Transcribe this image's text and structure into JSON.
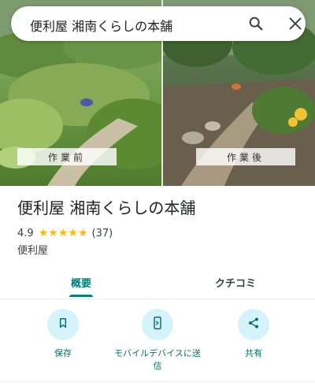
{
  "search": {
    "query": "便利屋 湘南くらしの本舗",
    "search_icon": "search-icon",
    "close_icon": "close-icon"
  },
  "photo": {
    "label_before": "作業前",
    "label_after": "作業後"
  },
  "place": {
    "name": "便利屋 湘南くらしの本舗",
    "rating": "4.9",
    "stars": 5,
    "review_count": "(37)",
    "category": "便利屋"
  },
  "tabs": [
    {
      "label": "概要",
      "active": true
    },
    {
      "label": "クチコミ",
      "active": false
    }
  ],
  "actions": [
    {
      "label": "保存",
      "icon": "bookmark-icon"
    },
    {
      "label": "モバイルデバイスに送信",
      "icon": "send-to-phone-icon"
    },
    {
      "label": "共有",
      "icon": "share-icon"
    }
  ],
  "colors": {
    "accent": "#0b7d7a",
    "action_circle": "#d5f3fb",
    "star": "#fbbc04"
  }
}
